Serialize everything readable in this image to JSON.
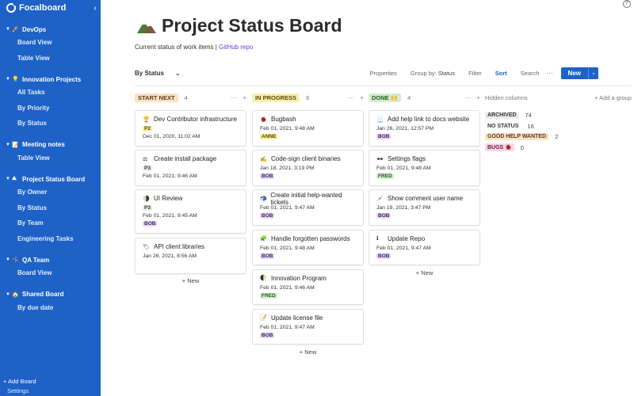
{
  "app": {
    "name": "Focalboard"
  },
  "sidebar": {
    "groups": [
      {
        "name": "DevOps",
        "emoji": "🚀",
        "views": [
          "Board View",
          "Table View"
        ]
      },
      {
        "name": "Innovation Projects",
        "emoji": "💡",
        "views": [
          "All Tasks",
          "By Priority",
          "By Status"
        ]
      },
      {
        "name": "Meeting notes",
        "emoji": "📝",
        "views": [
          "Table View"
        ]
      },
      {
        "name": "Project Status Board",
        "emoji": "⛰",
        "views": [
          "By Owner",
          "By Status",
          "By Team",
          "Engineering Tasks"
        ]
      },
      {
        "name": "QA Team",
        "emoji": "🤸",
        "views": [
          "Board View"
        ]
      },
      {
        "name": "Shared Board",
        "emoji": "🏠",
        "views": [
          "By due date"
        ]
      }
    ],
    "add_board": "+ Add Board",
    "settings": "Settings"
  },
  "board": {
    "title": "Project Status Board",
    "description": "Current status of work items | ",
    "description_link": "GitHub repo",
    "icon": "mountain-icon"
  },
  "toolbar": {
    "view_name": "By Status",
    "properties": "Properties",
    "group_by_label": "Group by: ",
    "group_by_value": "Status",
    "filter": "Filter",
    "sort": "Sort",
    "search": "Search",
    "more": "···",
    "new_label": "New"
  },
  "columns": [
    {
      "label": "START NEXT",
      "count": "4",
      "bg": "#fbe2c7",
      "color": "#5c3c12",
      "cards": [
        {
          "emoji": "🏆",
          "title": "Dev Contributor infrastructure",
          "pill": "P2",
          "pill_bg": "#f7ee9a",
          "pill_color": "#5b4a00",
          "date": "Dec 01, 2020, 11:02 AM",
          "pill_after": false
        },
        {
          "emoji": "⚖",
          "title": "Create install package",
          "pill": "P3",
          "pill_bg": "#ececec",
          "pill_color": "#333",
          "date": "Feb 01, 2021, 9:46 AM",
          "pill_after": false
        },
        {
          "emoji": "🌗",
          "title": "UI Review",
          "pill": "P3",
          "pill_bg": "#ececec",
          "pill_color": "#333",
          "date": "Feb 01, 2021, 9:45 AM",
          "pill2": "BOB",
          "pill2_bg": "#e5d7f4",
          "pill2_color": "#3d1f66"
        },
        {
          "emoji": "🏷",
          "title": "API client libraries",
          "pill": "",
          "date": "Jan 26, 2021, 8:56 AM"
        }
      ]
    },
    {
      "label": "IN PROGRESS",
      "count": "6",
      "bg": "#f8efb3",
      "color": "#5b4a00",
      "cards": [
        {
          "emoji": "🐞",
          "title": "Bugbash",
          "date": "Feb 01, 2021, 9:48 AM",
          "pill": "ANNE",
          "pill_bg": "#f7ee9a",
          "pill_color": "#5b4a00",
          "pill_after": true
        },
        {
          "emoji": "✍",
          "title": "Code-sign client binaries",
          "date": "Jan 18, 2021, 3:19 PM",
          "pill": "BOB",
          "pill_bg": "#e5d7f4",
          "pill_color": "#3d1f66",
          "pill_after": true
        },
        {
          "emoji": "📬",
          "title": "Create initial help-wanted tickets",
          "date": "Feb 01, 2021, 9:47 AM",
          "pill": "BOB",
          "pill_bg": "#e5d7f4",
          "pill_color": "#3d1f66",
          "pill_after": true
        },
        {
          "emoji": "🧩",
          "title": "Handle forgotten passwords",
          "date": "Feb 01, 2021, 9:48 AM",
          "pill": "BOB",
          "pill_bg": "#e5d7f4",
          "pill_color": "#3d1f66",
          "pill_after": true
        },
        {
          "emoji": "🌓",
          "title": "Innovation Program",
          "date": "Feb 01, 2021, 9:46 AM",
          "pill": "FRED",
          "pill_bg": "#d6ecd2",
          "pill_color": "#1f5a18",
          "pill_after": true
        },
        {
          "emoji": "📝",
          "title": "Update license file",
          "date": "Feb 01, 2021, 9:47 AM",
          "pill": "BOB",
          "pill_bg": "#e5d7f4",
          "pill_color": "#3d1f66",
          "pill_after": true
        }
      ]
    },
    {
      "label": "DONE 🙌",
      "count": "4",
      "bg": "#d6ecd2",
      "color": "#1f5a18",
      "cards": [
        {
          "emoji": "📃",
          "title": "Add help link to docs website",
          "date": "Jan 26, 2021, 12:57 PM",
          "pill": "BOB",
          "pill_bg": "#e5d7f4",
          "pill_color": "#3d1f66",
          "pill_after": true
        },
        {
          "emoji": "🕶",
          "title": "Settings flags",
          "date": "Feb 01, 2021, 9:48 AM",
          "pill": "FRED",
          "pill_bg": "#d6ecd2",
          "pill_color": "#1f5a18",
          "pill_after": true
        },
        {
          "emoji": "💉",
          "title": "Show comment user name",
          "date": "Jan 19, 2021, 3:47 PM",
          "pill": "BOB",
          "pill_bg": "#e5d7f4",
          "pill_color": "#3d1f66",
          "pill_after": true
        },
        {
          "emoji": "ℹ",
          "title": "Update Repo",
          "date": "Feb 01, 2021, 9:47 AM",
          "pill": "BOB",
          "pill_bg": "#e5d7f4",
          "pill_color": "#3d1f66",
          "pill_after": true
        }
      ]
    }
  ],
  "add_new": "+ New",
  "column_add": "+",
  "column_more": "···",
  "hidden_columns": {
    "title": "Hidden columns",
    "add_group": "+ Add a group",
    "items": [
      {
        "label": "ARCHIVED",
        "count": "74",
        "bg": "#ececec",
        "color": "#333"
      },
      {
        "label": "NO STATUS",
        "count": "16",
        "bg": "#ffffff",
        "color": "#333"
      },
      {
        "label": "GOOD HELP WANTED",
        "count": "2",
        "bg": "#fbe2c7",
        "color": "#5c3c12"
      },
      {
        "label": "BUGS 🐞",
        "count": "0",
        "bg": "#f8d6e6",
        "color": "#6b1740"
      }
    ]
  },
  "colors": {
    "accent": "#1e62c8",
    "link": "#6f3cc6"
  }
}
